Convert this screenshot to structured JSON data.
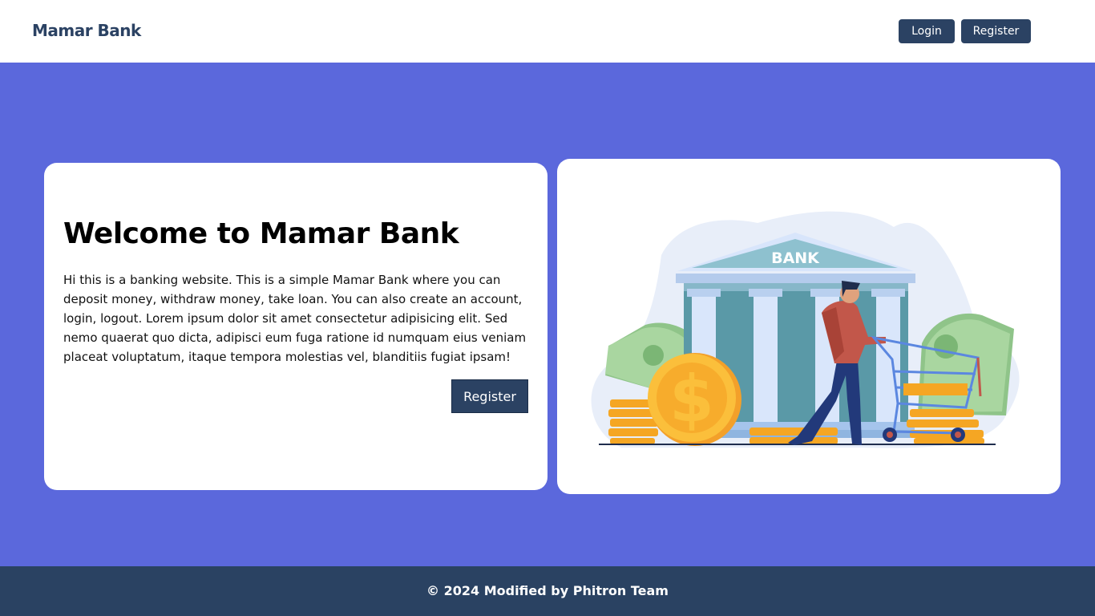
{
  "navbar": {
    "brand": "Mamar Bank",
    "login_label": "Login",
    "register_label": "Register"
  },
  "hero": {
    "title": "Welcome to Mamar Bank",
    "description": "Hi this is a banking website. This is a simple Mamar Bank where you can deposit money, withdraw money, take loan. You can also create an account, login, logout. Lorem ipsum dolor sit amet consectetur adipisicing elit. Sed nemo quaerat quo dicta, adipisci eum fuga ratione id numquam eius veniam placeat voluptatum, itaque tempora molestias vel, blanditiis fugiat ipsam!",
    "register_label": "Register",
    "illustration_sign": "BANK",
    "coin_symbol": "$"
  },
  "footer": {
    "text": "© 2024 Modified by Phitron Team"
  },
  "colors": {
    "primary": "#2b4263",
    "hero_bg": "#5b68dc",
    "footer_bg": "#2a4262"
  },
  "icons": {
    "illustration": "bank-shopping-cart-illustration"
  }
}
